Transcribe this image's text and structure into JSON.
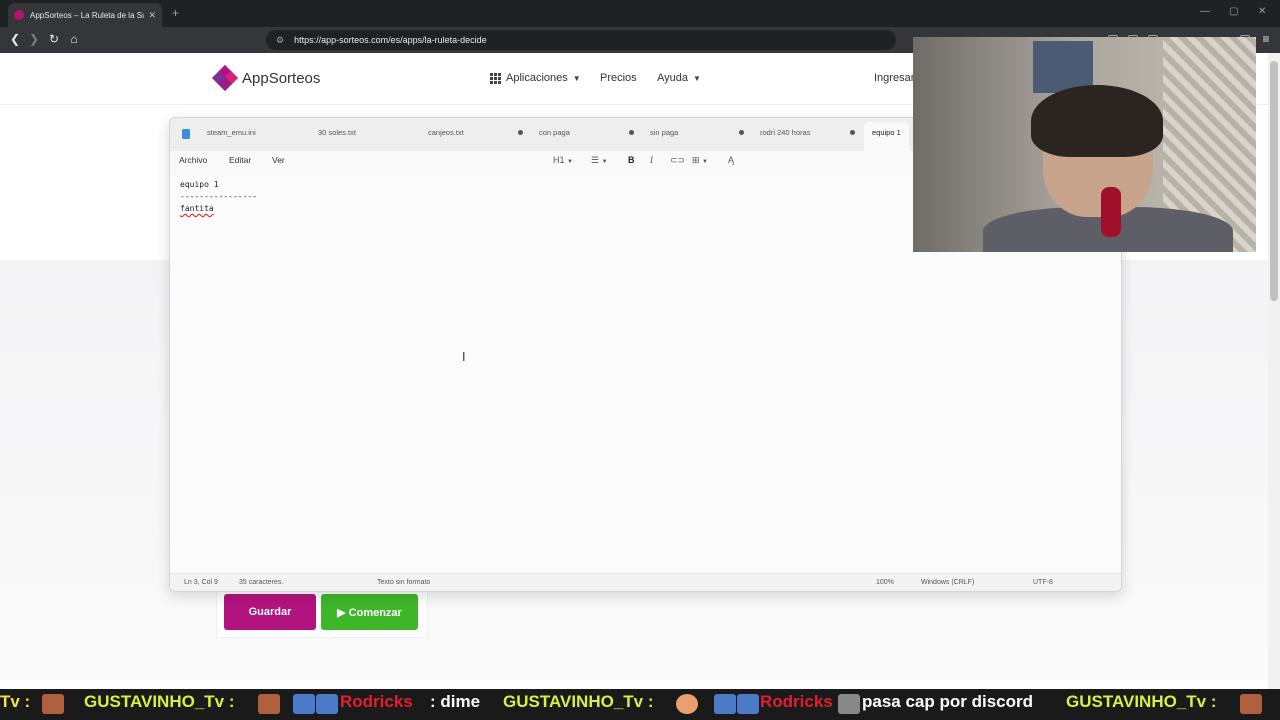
{
  "browser": {
    "tab_title": "AppSorteos – La Ruleta de la Su",
    "tab_close": "✕",
    "new_tab": "+",
    "url": "https://app-sorteos.com/es/apps/la-ruleta-decide",
    "icons": [
      "back-icon",
      "forward-icon",
      "reload-icon",
      "home-icon",
      "site-settings-icon"
    ]
  },
  "site": {
    "logo_text": "AppSorteos",
    "nav": {
      "aplicaciones": "Aplicaciones",
      "precios": "Precios",
      "ayuda": "Ayuda",
      "ingresar": "Ingresar"
    },
    "colors": {
      "brand": "#b3137e",
      "accent_green": "#3fb62a"
    }
  },
  "notepad": {
    "tabs": [
      {
        "label": "steam_emu.ini"
      },
      {
        "label": "30 soles.txt"
      },
      {
        "label": "canjeos.txt"
      },
      {
        "label": "con paga"
      },
      {
        "label": "sin paga"
      },
      {
        "label": "rodri 240 horas"
      },
      {
        "label": "equipo 1"
      }
    ],
    "menus": {
      "archivo": "Archivo",
      "editar": "Editar",
      "ver": "Ver"
    },
    "toolbar": {
      "heading": "H1",
      "bold": "B",
      "italic": "I"
    },
    "lines": [
      "equipo 1",
      "----------------",
      "fantita"
    ],
    "status": {
      "position": "Ln 3, Col 9",
      "chars": "35 caracteres.",
      "format": "Texto sin formato",
      "zoom": "100%",
      "eol": "Windows (CRLF)",
      "encoding": "UTF-8"
    }
  },
  "buttons": {
    "guardar": "Guardar",
    "comenzar": "▶ Comenzar"
  },
  "chat_ticker": {
    "items": [
      {
        "text": "Tv :",
        "color": "#f5e050"
      },
      {
        "text": "GUSTAVINHO_Tv :",
        "color": "#d8f040"
      },
      {
        "text": "Rodricks",
        "color": "#e02030"
      },
      {
        "text": ": dime",
        "color": "#ffffff"
      },
      {
        "text": "GUSTAVINHO_Tv :",
        "color": "#d8f040"
      },
      {
        "text": "Rodricks",
        "color": "#e02030"
      },
      {
        "text": "pasa cap por discord",
        "color": "#ffffff"
      },
      {
        "text": "GUSTAVINHO_Tv :",
        "color": "#d8f040"
      }
    ]
  }
}
